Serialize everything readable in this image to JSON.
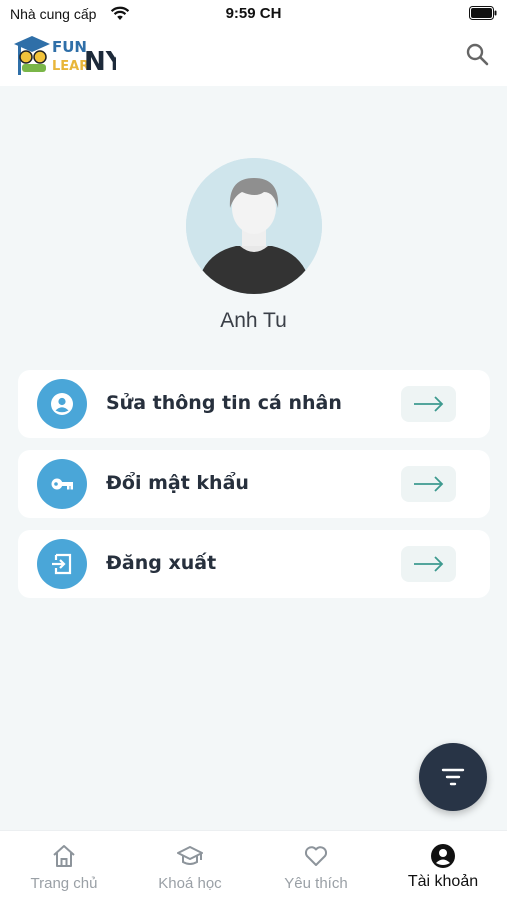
{
  "status_bar": {
    "carrier": "Nhà cung cấp",
    "time": "9:59 CH",
    "wifi_icon": "wifi-icon",
    "battery_icon": "battery-icon"
  },
  "header": {
    "logo_text_line1": "FUNNY",
    "logo_text_line2": "LEARN",
    "search_icon": "search-icon"
  },
  "profile": {
    "name": "Anh Tu",
    "avatar_icon": "avatar-silhouette"
  },
  "menu": [
    {
      "label": "Sửa thông tin cá nhân",
      "icon": "user-circle-icon"
    },
    {
      "label": "Đổi mật khẩu",
      "icon": "key-icon"
    },
    {
      "label": "Đăng xuất",
      "icon": "logout-icon"
    }
  ],
  "fab": {
    "icon": "filter-icon"
  },
  "bottom_nav": [
    {
      "label": "Trang chủ",
      "icon": "home-icon",
      "active": false
    },
    {
      "label": "Khoá học",
      "icon": "graduation-cap-icon",
      "active": false
    },
    {
      "label": "Yêu thích",
      "icon": "heart-icon",
      "active": false
    },
    {
      "label": "Tài khoản",
      "icon": "account-icon",
      "active": true
    }
  ],
  "colors": {
    "accent": "#4aa6d8",
    "fab": "#283446",
    "background": "#f3f7f8",
    "arrow": "#3d9a8f"
  }
}
